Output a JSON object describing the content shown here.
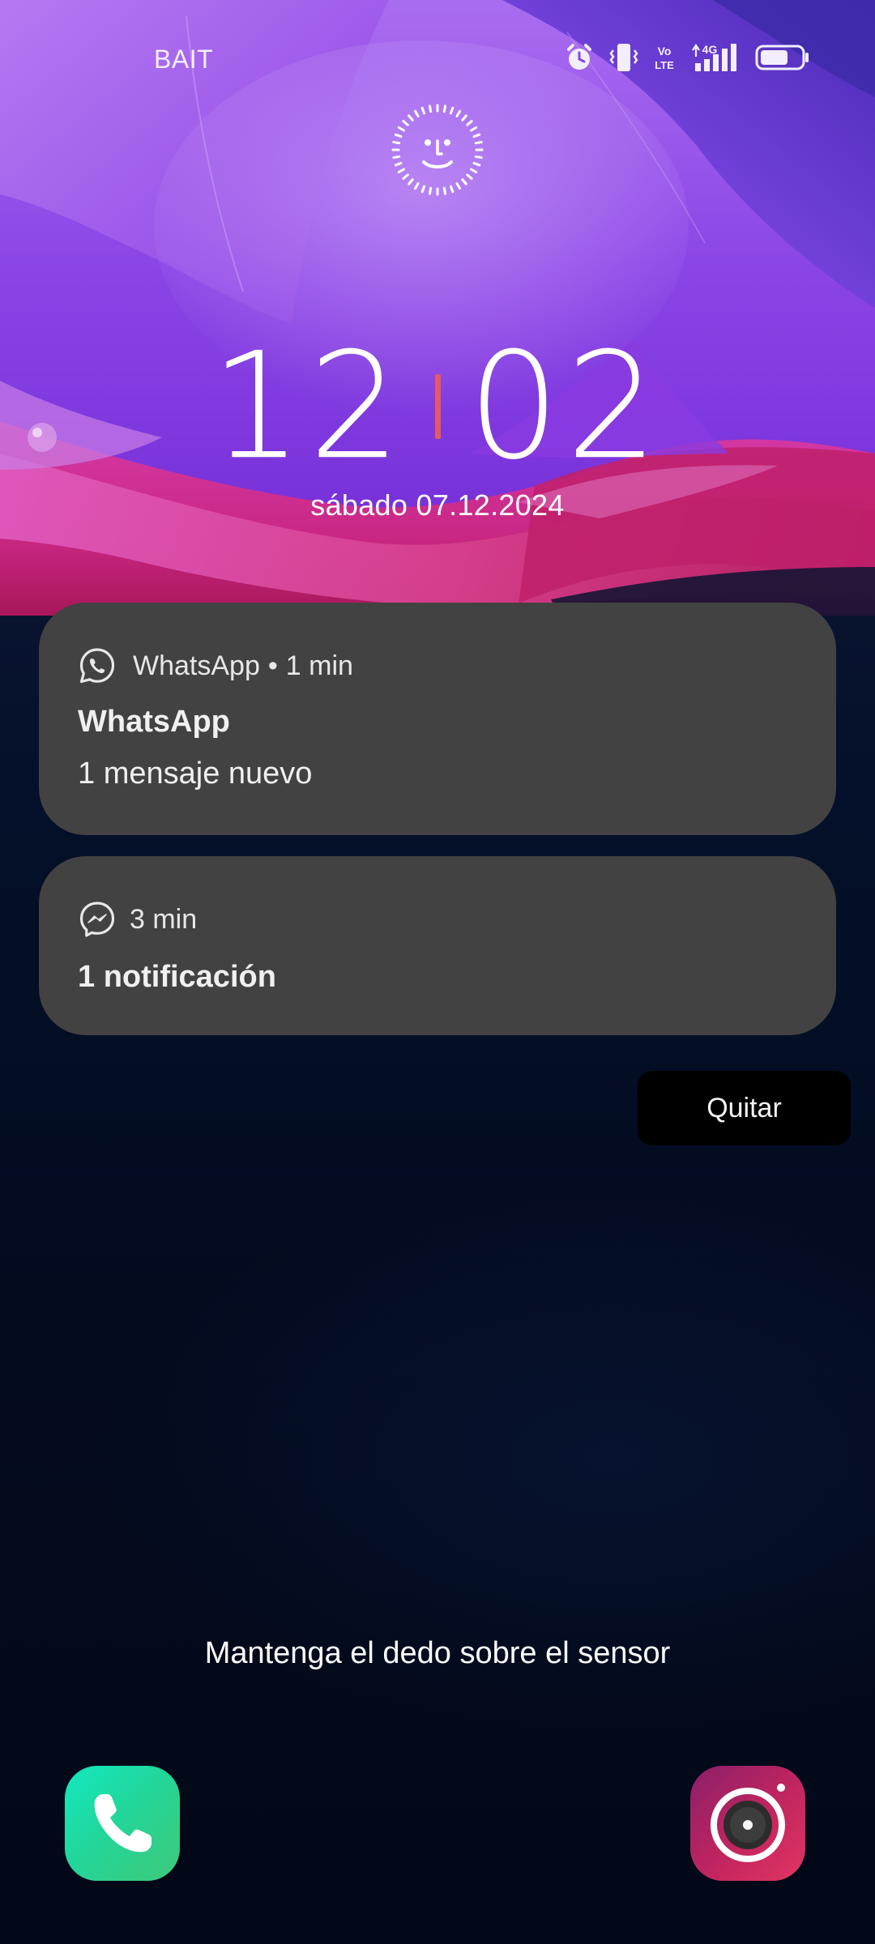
{
  "status_bar": {
    "carrier": "BAIT",
    "icons": [
      "alarm-icon",
      "vibrate-icon",
      "volte-icon",
      "signal-4g-icon",
      "battery-icon"
    ],
    "network_label": "4G",
    "volte_label": "Vo LTE",
    "battery_level_percent": 65
  },
  "lock_screen": {
    "face_unlock_icon": "face-unlock-icon",
    "clock_hours": "12",
    "clock_minutes": "02",
    "date": "sábado 07.12.2024",
    "accent_color": "#e35a66"
  },
  "notifications": [
    {
      "app_icon": "whatsapp-icon",
      "app_name": "WhatsApp",
      "separator": "•",
      "time": "1 min",
      "title": "WhatsApp",
      "body": "1 mensaje nuevo"
    },
    {
      "app_icon": "messenger-icon",
      "time": "3 min",
      "title": "1 notificación"
    }
  ],
  "clear_button": {
    "label": "Quitar"
  },
  "fingerprint_hint": "Mantenga el dedo sobre el sensor",
  "shortcuts": {
    "phone": "phone-icon",
    "camera": "camera-icon"
  },
  "colors": {
    "notification_bg": "#424242",
    "background": "#020817",
    "phone_shortcut": "#22d69b",
    "camera_shortcut": "#c2255f"
  }
}
